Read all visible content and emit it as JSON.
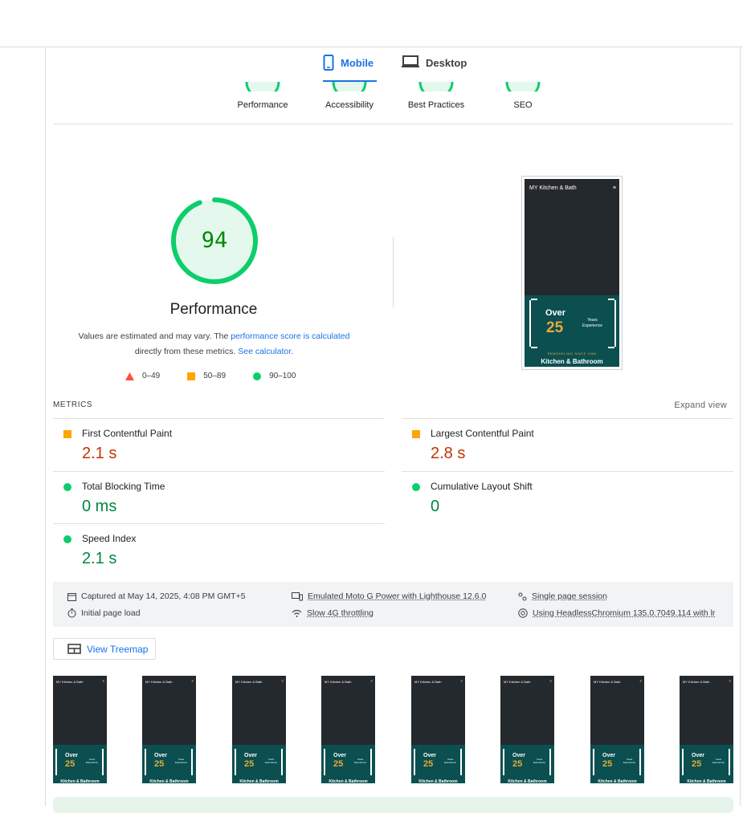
{
  "tabs": {
    "mobile": "Mobile",
    "desktop": "Desktop",
    "active": "mobile"
  },
  "categories": [
    {
      "label": "Performance"
    },
    {
      "label": "Accessibility"
    },
    {
      "label": "Best Practices"
    },
    {
      "label": "SEO"
    }
  ],
  "performance": {
    "score": "94",
    "title": "Performance",
    "desc_prefix": "Values are estimated and may vary. The ",
    "desc_link1": "performance score is calculated",
    "desc_mid": " directly from these metrics. ",
    "desc_link2": "See calculator."
  },
  "legend": {
    "fail": "0–49",
    "average": "50–89",
    "pass": "90–100"
  },
  "screenshot": {
    "brand": "MY Kitchen & Bath",
    "over": "Over",
    "number": "25",
    "years": "Years",
    "experience": "Experience",
    "remodeling": "REMODELING SINCE 1996",
    "headline": "Kitchen & Bathroom"
  },
  "metrics": {
    "title": "METRICS",
    "expand": "Expand view",
    "items": [
      {
        "name": "First Contentful Paint",
        "value": "2.1 s",
        "rating": "average"
      },
      {
        "name": "Largest Contentful Paint",
        "value": "2.8 s",
        "rating": "average"
      },
      {
        "name": "Total Blocking Time",
        "value": "0 ms",
        "rating": "pass"
      },
      {
        "name": "Cumulative Layout Shift",
        "value": "0",
        "rating": "pass"
      },
      {
        "name": "Speed Index",
        "value": "2.1 s",
        "rating": "pass"
      }
    ]
  },
  "runtime": {
    "captured": "Captured at May 14, 2025, 4:08 PM GMT+5",
    "initial": "Initial page load",
    "emulated": "Emulated Moto G Power with Lighthouse 12.6.0",
    "throttling": "Slow 4G throttling",
    "session": "Single page session",
    "browser": "Using HeadlessChromium 135.0.7049.114 with lr"
  },
  "treemap": {
    "label": "View Treemap"
  },
  "filmstrip": {
    "brand": "MY Kitchen & Bath",
    "over": "Over",
    "number": "25",
    "years": "Years",
    "experience": "Experience",
    "headline": "Kitchen & Bathroom",
    "frames": 8
  },
  "colors": {
    "accent": "#1a73e8",
    "pass": "#0cce6b",
    "average": "#ffa400",
    "fail": "#ff4e42",
    "average_text": "#c33300",
    "pass_text": "#018642"
  }
}
